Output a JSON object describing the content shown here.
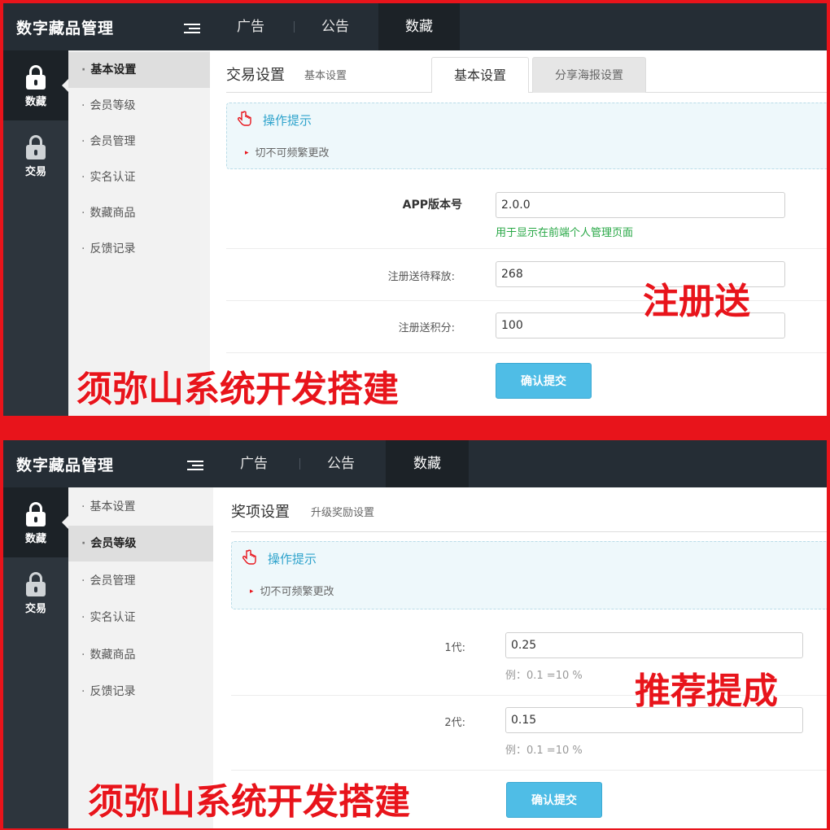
{
  "panel1": {
    "app_title": "数字藏品管理",
    "top_tabs": [
      "广告",
      "公告",
      "数藏"
    ],
    "left_nav": [
      "数藏",
      "交易"
    ],
    "submenu": [
      "基本设置",
      "会员等级",
      "会员管理",
      "实名认证",
      "数藏商品",
      "反馈记录"
    ],
    "page_title": "交易设置",
    "page_subtitle": "基本设置",
    "sub_tabs": [
      "基本设置",
      "分享海报设置"
    ],
    "tip_title": "操作提示",
    "tip_text": "切不可频繁更改",
    "fields": [
      {
        "label": "APP版本号",
        "value": "2.0.0",
        "hint": "用于显示在前端个人管理页面"
      },
      {
        "label": "注册送待释放:",
        "value": "268"
      },
      {
        "label": "注册送积分:",
        "value": "100"
      }
    ],
    "submit_label": "确认提交",
    "overlay_right": "注册送",
    "overlay_bottom": "须弥山系统开发搭建"
  },
  "panel2": {
    "app_title": "数字藏品管理",
    "top_tabs": [
      "广告",
      "公告",
      "数藏"
    ],
    "left_nav": [
      "数藏",
      "交易"
    ],
    "submenu": [
      "基本设置",
      "会员等级",
      "会员管理",
      "实名认证",
      "数藏商品",
      "反馈记录"
    ],
    "page_title": "奖项设置",
    "page_subtitle": "升级奖励设置",
    "tip_title": "操作提示",
    "tip_text": "切不可频繁更改",
    "fields": [
      {
        "label": "1代:",
        "value": "0.25",
        "hint": "例：0.1 =10 %"
      },
      {
        "label": "2代:",
        "value": "0.15",
        "hint": "例：0.1 =10 %"
      }
    ],
    "submit_label": "确认提交",
    "overlay_right": "推荐提成",
    "overlay_bottom": "须弥山系统开发搭建"
  },
  "icons": {
    "lock": "lock-icon",
    "menu": "menu-toggle-icon",
    "tip": "pointer-hand-icon"
  },
  "colors": {
    "topbar": "#252d35",
    "accent_blue": "#4fbde6",
    "overlay_red": "#e8141b",
    "hint_green": "#27a745"
  }
}
